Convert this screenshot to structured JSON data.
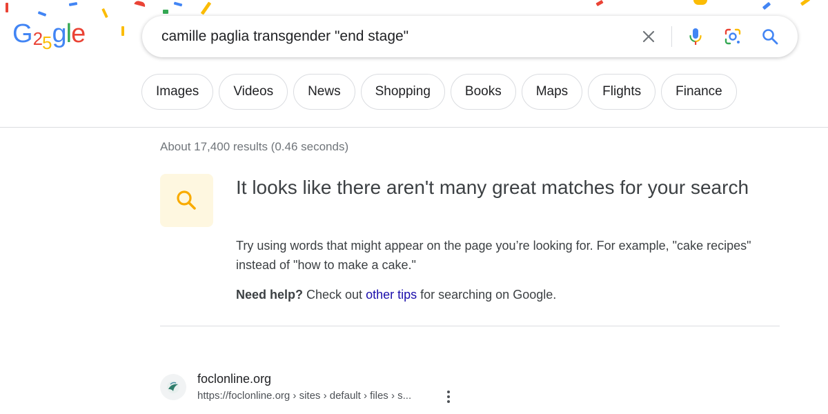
{
  "logo": {
    "letters": [
      "G",
      "2",
      "5",
      "g",
      "l",
      "e"
    ]
  },
  "search": {
    "query": "camille paglia transgender \"end stage\""
  },
  "filters": [
    "Images",
    "Videos",
    "News",
    "Shopping",
    "Books",
    "Maps",
    "Flights",
    "Finance"
  ],
  "stats": "About 17,400 results (0.46 seconds)",
  "notice": {
    "title": "It looks like there aren't many great matches for your search",
    "body": "Try using words that might appear on the page you’re looking for. For example, \"cake recipes\" instead of \"how to make a cake.\"",
    "help_bold": "Need help?",
    "help_pre": " Check out ",
    "help_link": "other tips",
    "help_post": " for searching on Google."
  },
  "result": {
    "site": "foclonline.org",
    "url": "https://foclonline.org › sites › default › files › s..."
  },
  "colors": {
    "blue": "#4285f4",
    "red": "#ea4335",
    "yellow": "#fbbc05",
    "green": "#34a853",
    "link": "#1a0dab"
  }
}
